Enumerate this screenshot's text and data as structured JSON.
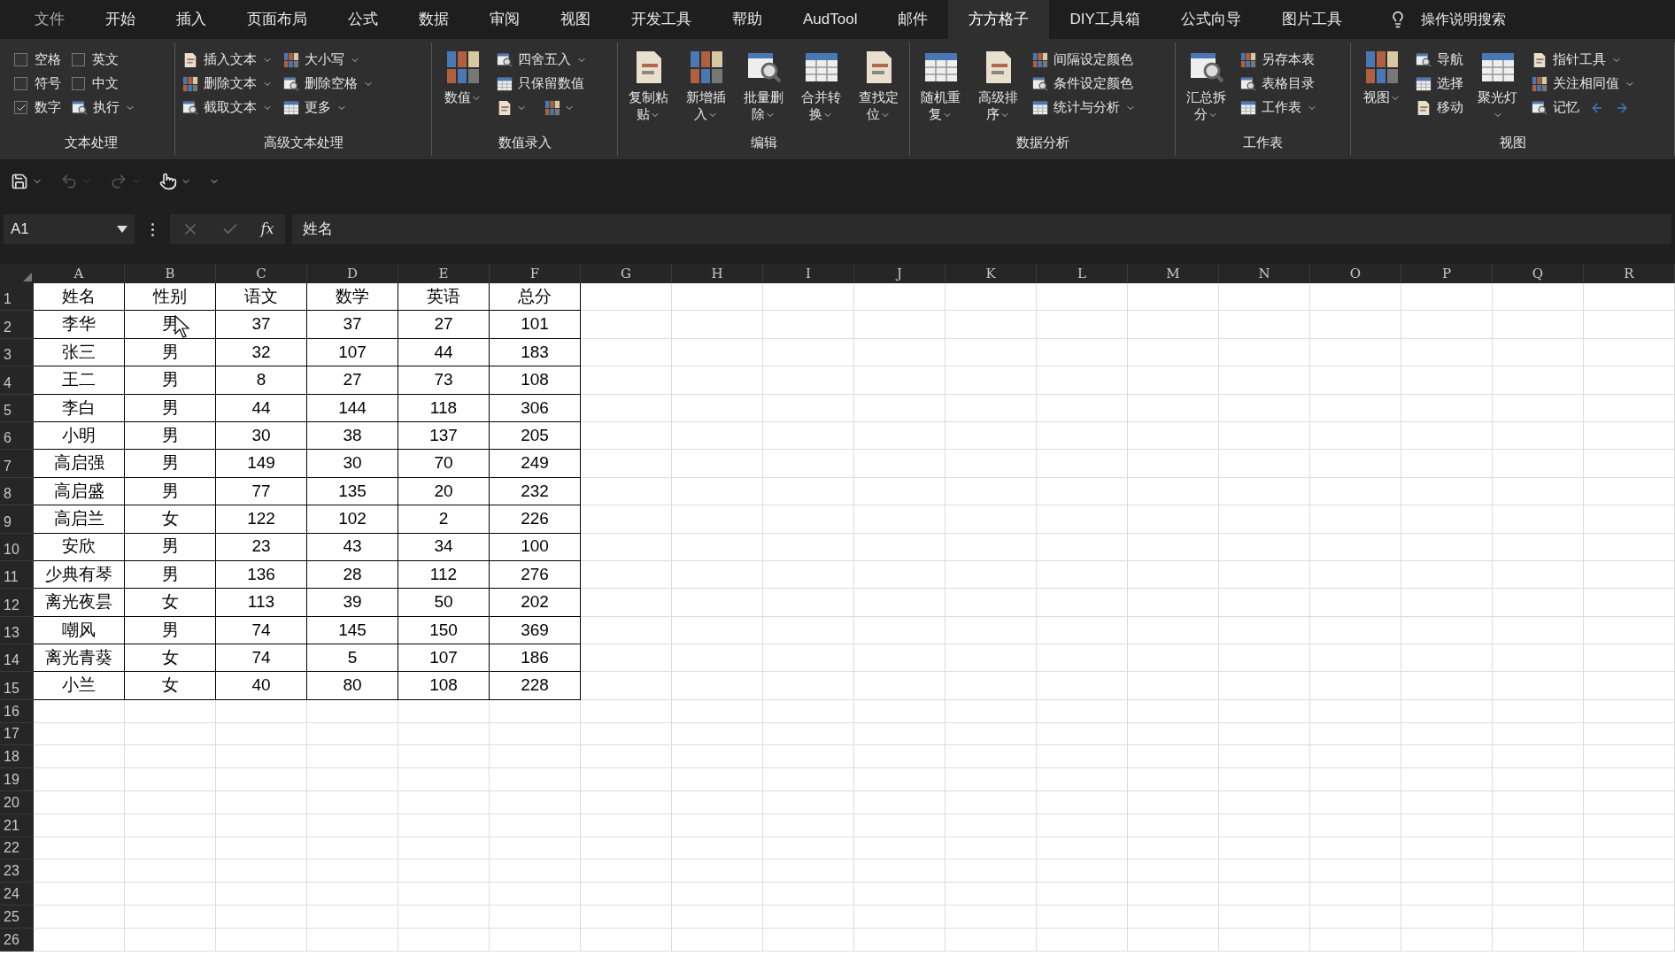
{
  "menu_tabs": [
    {
      "label": "文件",
      "selected": false
    },
    {
      "label": "开始",
      "selected": false
    },
    {
      "label": "插入",
      "selected": false
    },
    {
      "label": "页面布局",
      "selected": false
    },
    {
      "label": "公式",
      "selected": false
    },
    {
      "label": "数据",
      "selected": false
    },
    {
      "label": "审阅",
      "selected": false
    },
    {
      "label": "视图",
      "selected": false
    },
    {
      "label": "开发工具",
      "selected": false
    },
    {
      "label": "帮助",
      "selected": false
    },
    {
      "label": "AudTool",
      "selected": false
    },
    {
      "label": "邮件",
      "selected": false
    },
    {
      "label": "方方格子",
      "selected": true
    },
    {
      "label": "DIY工具箱",
      "selected": false
    },
    {
      "label": "公式向导",
      "selected": false
    },
    {
      "label": "图片工具",
      "selected": false
    }
  ],
  "tell_me": "操作说明搜索",
  "ribbon_groups": [
    {
      "title": "文本处理",
      "columns": [
        {
          "kind": "stack",
          "items": [
            {
              "kind": "checkbox",
              "label": "空格",
              "checked": false
            },
            {
              "kind": "checkbox",
              "label": "符号",
              "checked": false
            },
            {
              "kind": "checkbox",
              "label": "数字",
              "checked": true
            }
          ]
        },
        {
          "kind": "stack",
          "items": [
            {
              "kind": "checkbox",
              "label": "英文",
              "checked": false
            },
            {
              "kind": "checkbox",
              "label": "中文",
              "checked": false
            },
            {
              "kind": "small",
              "label": "执行",
              "dropdown": true
            }
          ]
        }
      ]
    },
    {
      "title": "高级文本处理",
      "columns": [
        {
          "kind": "stack",
          "items": [
            {
              "kind": "small",
              "label": "插入文本",
              "dropdown": true
            },
            {
              "kind": "small",
              "label": "删除文本",
              "dropdown": true
            },
            {
              "kind": "small",
              "label": "截取文本",
              "dropdown": true
            }
          ]
        },
        {
          "kind": "stack",
          "items": [
            {
              "kind": "small",
              "label": "大小写",
              "dropdown": true
            },
            {
              "kind": "small",
              "label": "删除空格",
              "dropdown": true
            },
            {
              "kind": "small",
              "label": "更多",
              "dropdown": true
            }
          ]
        }
      ]
    },
    {
      "title": "数值录入",
      "columns": [
        {
          "kind": "large",
          "label": "数值",
          "dropdown": true
        },
        {
          "kind": "stack",
          "items": [
            {
              "kind": "small",
              "label": "四舍五入",
              "dropdown": true
            },
            {
              "kind": "small",
              "label": "只保留数值",
              "dropdown": false
            },
            {
              "kind": "icon_row",
              "buttons": [
                {
                  "dropdown": true
                },
                {
                  "dropdown": true
                }
              ]
            }
          ]
        }
      ]
    },
    {
      "title": "编辑",
      "columns": [
        {
          "kind": "large",
          "label": "复制粘贴",
          "dropdown": true
        },
        {
          "kind": "large",
          "label": "新增插入",
          "dropdown": true
        },
        {
          "kind": "large",
          "label": "批量删除",
          "dropdown": true
        },
        {
          "kind": "large",
          "label": "合并转换",
          "dropdown": true
        },
        {
          "kind": "large",
          "label": "查找定位",
          "dropdown": true
        }
      ]
    },
    {
      "title": "数据分析",
      "columns": [
        {
          "kind": "large",
          "label": "随机重复",
          "dropdown": true
        },
        {
          "kind": "large",
          "label": "高级排序",
          "dropdown": true
        },
        {
          "kind": "stack",
          "items": [
            {
              "kind": "small",
              "label": "间隔设定颜色",
              "dropdown": false
            },
            {
              "kind": "small",
              "label": "条件设定颜色",
              "dropdown": false
            },
            {
              "kind": "small",
              "label": "统计与分析",
              "dropdown": true
            }
          ]
        }
      ]
    },
    {
      "title": "工作表",
      "columns": [
        {
          "kind": "large",
          "label": "汇总拆分",
          "dropdown": true
        },
        {
          "kind": "stack",
          "items": [
            {
              "kind": "small",
              "label": "另存本表",
              "dropdown": false
            },
            {
              "kind": "small",
              "label": "表格目录",
              "dropdown": false
            },
            {
              "kind": "small",
              "label": "工作表",
              "dropdown": true
            }
          ]
        }
      ]
    },
    {
      "title": "视图",
      "columns": [
        {
          "kind": "large",
          "label": "视图",
          "dropdown": true
        },
        {
          "kind": "stack",
          "items": [
            {
              "kind": "small",
              "label": "导航",
              "dropdown": false
            },
            {
              "kind": "small",
              "label": "选择",
              "dropdown": false
            },
            {
              "kind": "small",
              "label": "移动",
              "dropdown": false
            }
          ]
        },
        {
          "kind": "large",
          "label": "聚光灯",
          "dropdown": true
        },
        {
          "kind": "stack",
          "items": [
            {
              "kind": "small",
              "label": "指针工具",
              "dropdown": true
            },
            {
              "kind": "small",
              "label": "关注相同值",
              "dropdown": true
            },
            {
              "kind": "nav",
              "label": "记忆",
              "dropdown": false
            }
          ]
        }
      ]
    }
  ],
  "quick_access": [
    {
      "kind": "save",
      "disabled": false
    },
    {
      "kind": "undo",
      "disabled": true
    },
    {
      "kind": "redo",
      "disabled": true
    },
    {
      "kind": "touch",
      "disabled": false
    },
    {
      "kind": "customize",
      "disabled": false
    }
  ],
  "formula_bar": {
    "name_box": "A1",
    "fx": "fx",
    "value": "姓名"
  },
  "sheet": {
    "columns": [
      "A",
      "B",
      "C",
      "D",
      "E",
      "F",
      "G",
      "H",
      "I",
      "J",
      "K",
      "L",
      "M",
      "N",
      "O",
      "P",
      "Q",
      "R"
    ],
    "rows": [
      {
        "header": "1",
        "cells": [
          "姓名",
          "性别",
          "语文",
          "数学",
          "英语",
          "总分"
        ]
      },
      {
        "header": "2",
        "cells": [
          "李华",
          "男",
          "37",
          "37",
          "27",
          "101"
        ]
      },
      {
        "header": "3",
        "cells": [
          "张三",
          "男",
          "32",
          "107",
          "44",
          "183"
        ]
      },
      {
        "header": "4",
        "cells": [
          "王二",
          "男",
          "8",
          "27",
          "73",
          "108"
        ]
      },
      {
        "header": "5",
        "cells": [
          "李白",
          "男",
          "44",
          "144",
          "118",
          "306"
        ]
      },
      {
        "header": "6",
        "cells": [
          "小明",
          "男",
          "30",
          "38",
          "137",
          "205"
        ]
      },
      {
        "header": "7",
        "cells": [
          "高启强",
          "男",
          "149",
          "30",
          "70",
          "249"
        ]
      },
      {
        "header": "8",
        "cells": [
          "高启盛",
          "男",
          "77",
          "135",
          "20",
          "232"
        ]
      },
      {
        "header": "9",
        "cells": [
          "高启兰",
          "女",
          "122",
          "102",
          "2",
          "226"
        ]
      },
      {
        "header": "10",
        "cells": [
          "安欣",
          "男",
          "23",
          "43",
          "34",
          "100"
        ]
      },
      {
        "header": "11",
        "cells": [
          "少典有琴",
          "男",
          "136",
          "28",
          "112",
          "276"
        ]
      },
      {
        "header": "12",
        "cells": [
          "离光夜昙",
          "女",
          "113",
          "39",
          "50",
          "202"
        ]
      },
      {
        "header": "13",
        "cells": [
          "嘲风",
          "男",
          "74",
          "145",
          "150",
          "369"
        ]
      },
      {
        "header": "14",
        "cells": [
          "离光青葵",
          "女",
          "74",
          "5",
          "107",
          "186"
        ]
      },
      {
        "header": "15",
        "cells": [
          "小兰",
          "女",
          "40",
          "80",
          "108",
          "228"
        ]
      },
      {
        "header": "16"
      },
      {
        "header": "17"
      },
      {
        "header": "18"
      },
      {
        "header": "19"
      },
      {
        "header": "20"
      },
      {
        "header": "21"
      },
      {
        "header": "22"
      },
      {
        "header": "23"
      },
      {
        "header": "24"
      },
      {
        "header": "25"
      },
      {
        "header": "26"
      }
    ]
  }
}
